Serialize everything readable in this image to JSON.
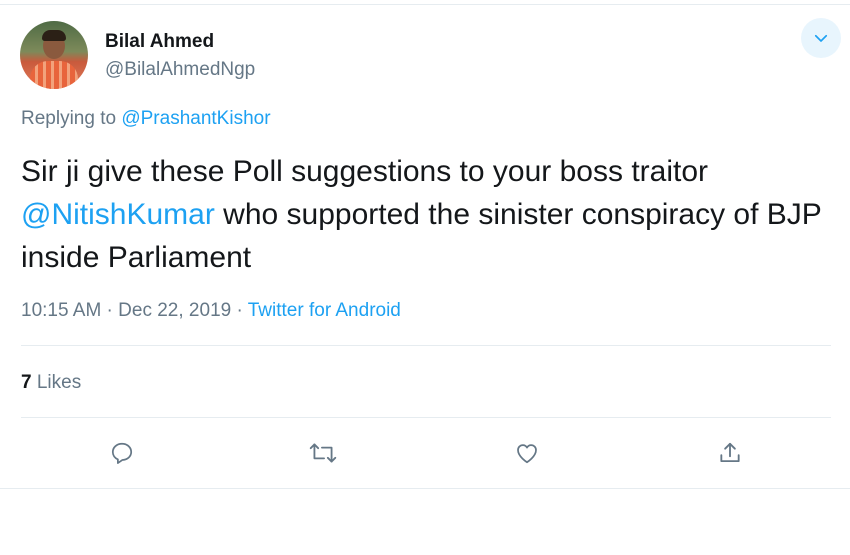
{
  "tweet": {
    "author_name": "Bilal Ahmed",
    "author_handle": "@BilalAhmedNgp",
    "replying_prefix": "Replying to ",
    "replying_to": "@PrashantKishor",
    "text_part1": "Sir ji give these Poll suggestions to your boss traitor ",
    "text_mention": "@NitishKumar",
    "text_part2": " who supported the sinister conspiracy of BJP inside Parliament",
    "time": "10:15 AM",
    "date": "Dec 22, 2019",
    "separator": " · ",
    "source": "Twitter for Android",
    "likes_count": "7",
    "likes_label": " Likes"
  },
  "icons": {
    "more": "chevron-down-icon",
    "reply": "reply-icon",
    "retweet": "retweet-icon",
    "like": "heart-icon",
    "share": "share-icon"
  },
  "colors": {
    "accent": "#1da1f2",
    "secondary_text": "#657786",
    "primary_text": "#14171a",
    "divider": "#e6ecf0"
  }
}
